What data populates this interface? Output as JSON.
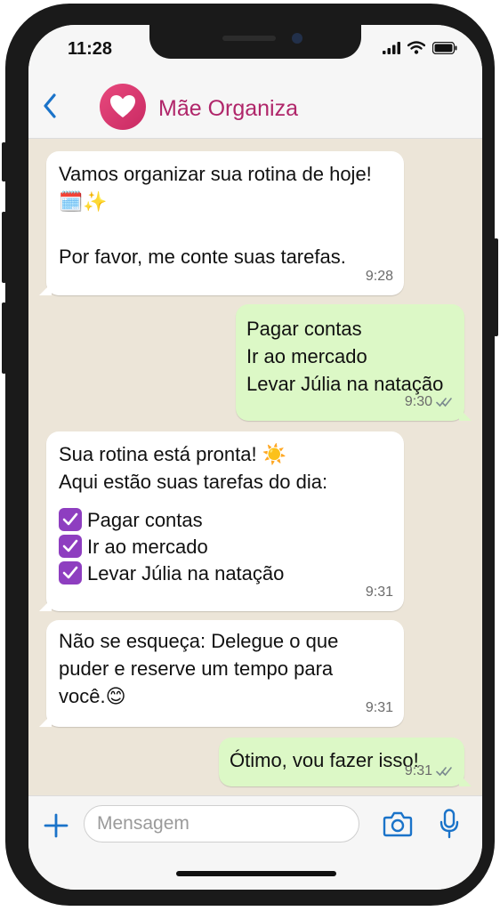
{
  "status": {
    "time": "11:28"
  },
  "header": {
    "contact_name": "Mãe Organiza"
  },
  "messages": [
    {
      "direction": "in",
      "text": "Vamos organizar sua rotina de hoje! 🗓️✨\n\nPor favor, me conte suas tarefas.",
      "time": "9:28"
    },
    {
      "direction": "out",
      "text": "Pagar contas\nIr ao mercado\nLevar Júlia na natação",
      "time": "9:30",
      "ticks": "read"
    },
    {
      "direction": "in",
      "intro": "Sua rotina está pronta! ☀️\nAqui estão suas tarefas do dia:",
      "tasks": [
        "Pagar contas",
        "Ir ao mercado",
        "Levar Júlia na natação"
      ],
      "time": "9:31"
    },
    {
      "direction": "in",
      "text": "Não se esqueça: Delegue o que puder e reserve um tempo para você.😊",
      "time": "9:31"
    },
    {
      "direction": "out",
      "text": "Ótimo, vou fazer isso!",
      "time": "9:31",
      "ticks": "read"
    }
  ],
  "input": {
    "placeholder": "Mensagem",
    "value": ""
  },
  "colors": {
    "accent": "#1a73c9",
    "brand": "#b0266a",
    "outgoing_bubble": "#dcf8c6",
    "incoming_bubble": "#ffffff",
    "chat_background": "#ece5d8",
    "checkbox": "#8e3ec0"
  },
  "icons": [
    "back-chevron-icon",
    "heart-icon",
    "signal-icon",
    "wifi-icon",
    "battery-icon",
    "double-check-icon",
    "checkbox-icon",
    "plus-icon",
    "camera-icon",
    "mic-icon"
  ]
}
